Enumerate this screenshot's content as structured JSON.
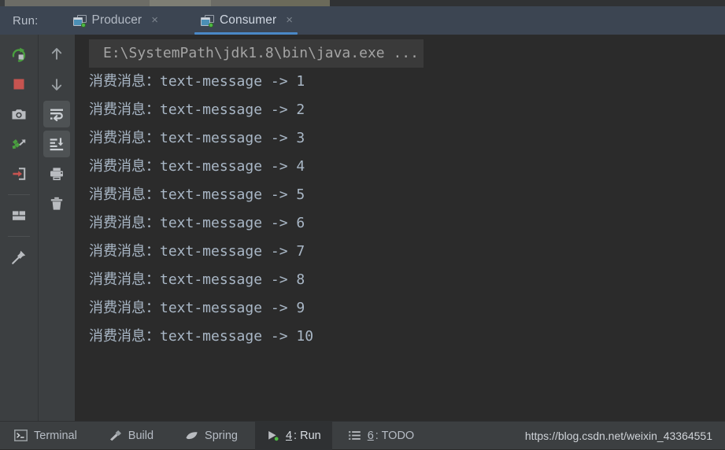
{
  "header": {
    "run_label": "Run:",
    "tabs": [
      {
        "label": "Producer",
        "icon": "window-icon",
        "close": "×",
        "active": false
      },
      {
        "label": "Consumer",
        "icon": "window-icon",
        "close": "×",
        "active": true
      }
    ]
  },
  "toolbar_left": [
    {
      "name": "rerun-icon",
      "title": "Rerun"
    },
    {
      "name": "stop-icon",
      "title": "Stop"
    },
    {
      "name": "camera-icon",
      "title": "Capture Memory Snapshot"
    },
    {
      "name": "thread-dump-icon",
      "title": "Dump Threads"
    },
    {
      "name": "export-icon",
      "title": "Export to Text File"
    },
    {
      "name": "layout-icon",
      "title": "Layout Settings"
    },
    {
      "name": "pin-icon",
      "title": "Pin Tab"
    }
  ],
  "toolbar_right": [
    {
      "name": "arrow-up-icon",
      "title": "Up the Stack Trace"
    },
    {
      "name": "arrow-down-icon",
      "title": "Down the Stack Trace"
    },
    {
      "name": "soft-wrap-icon",
      "title": "Use Soft Wraps",
      "toggled": true
    },
    {
      "name": "scroll-to-end-icon",
      "title": "Scroll to End",
      "toggled": true
    },
    {
      "name": "print-icon",
      "title": "Print"
    },
    {
      "name": "trash-icon",
      "title": "Clear All"
    }
  ],
  "console": {
    "command_line": "E:\\SystemPath\\jdk1.8\\bin\\java.exe ...",
    "lines": [
      "消费消息：text-message -> 1",
      "消费消息：text-message -> 2",
      "消费消息：text-message -> 3",
      "消费消息：text-message -> 4",
      "消费消息：text-message -> 5",
      "消费消息：text-message -> 6",
      "消费消息：text-message -> 7",
      "消费消息：text-message -> 8",
      "消费消息：text-message -> 9",
      "消费消息：text-message -> 10"
    ]
  },
  "statusbar": {
    "items": [
      {
        "label": "Terminal",
        "icon": "terminal-icon",
        "active": false,
        "mnemonic": ""
      },
      {
        "label": "Build",
        "icon": "hammer-icon",
        "active": false,
        "mnemonic": ""
      },
      {
        "label": "Spring",
        "icon": "leaf-icon",
        "active": false,
        "mnemonic": ""
      },
      {
        "label": ": Run",
        "icon": "play-icon",
        "active": true,
        "mnemonic": "4"
      },
      {
        "label": ": TODO",
        "icon": "list-icon",
        "active": false,
        "mnemonic": "6"
      }
    ],
    "watermark": "https://blog.csdn.net/weixin_43364551"
  },
  "colors": {
    "header_bg": "#3c4552",
    "console_bg": "#2b2b2b",
    "rail_bg": "#3c3f41",
    "accent_tab_underline": "#4a88c7",
    "console_text": "#a9b7c6",
    "command_text": "#a4a4a4",
    "run_green": "#4fbb44",
    "stop_red": "#c75450"
  }
}
